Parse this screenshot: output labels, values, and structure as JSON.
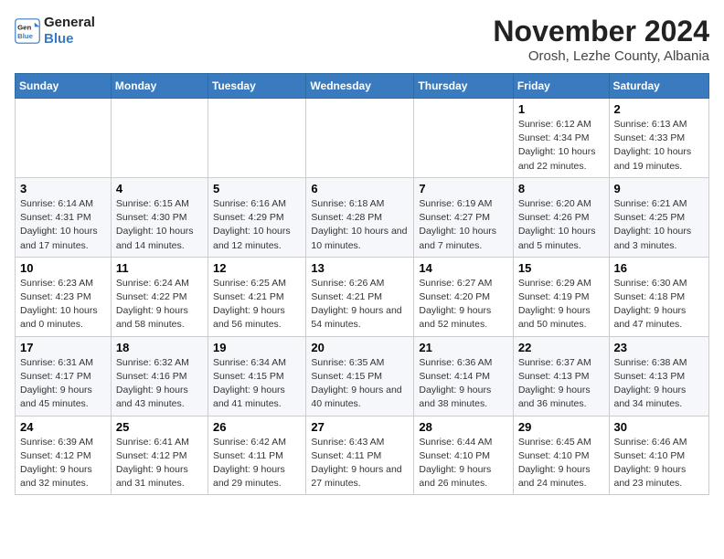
{
  "logo": {
    "line1": "General",
    "line2": "Blue"
  },
  "title": "November 2024",
  "location": "Orosh, Lezhe County, Albania",
  "headers": [
    "Sunday",
    "Monday",
    "Tuesday",
    "Wednesday",
    "Thursday",
    "Friday",
    "Saturday"
  ],
  "weeks": [
    [
      {
        "day": "",
        "info": ""
      },
      {
        "day": "",
        "info": ""
      },
      {
        "day": "",
        "info": ""
      },
      {
        "day": "",
        "info": ""
      },
      {
        "day": "",
        "info": ""
      },
      {
        "day": "1",
        "info": "Sunrise: 6:12 AM\nSunset: 4:34 PM\nDaylight: 10 hours and 22 minutes."
      },
      {
        "day": "2",
        "info": "Sunrise: 6:13 AM\nSunset: 4:33 PM\nDaylight: 10 hours and 19 minutes."
      }
    ],
    [
      {
        "day": "3",
        "info": "Sunrise: 6:14 AM\nSunset: 4:31 PM\nDaylight: 10 hours and 17 minutes."
      },
      {
        "day": "4",
        "info": "Sunrise: 6:15 AM\nSunset: 4:30 PM\nDaylight: 10 hours and 14 minutes."
      },
      {
        "day": "5",
        "info": "Sunrise: 6:16 AM\nSunset: 4:29 PM\nDaylight: 10 hours and 12 minutes."
      },
      {
        "day": "6",
        "info": "Sunrise: 6:18 AM\nSunset: 4:28 PM\nDaylight: 10 hours and 10 minutes."
      },
      {
        "day": "7",
        "info": "Sunrise: 6:19 AM\nSunset: 4:27 PM\nDaylight: 10 hours and 7 minutes."
      },
      {
        "day": "8",
        "info": "Sunrise: 6:20 AM\nSunset: 4:26 PM\nDaylight: 10 hours and 5 minutes."
      },
      {
        "day": "9",
        "info": "Sunrise: 6:21 AM\nSunset: 4:25 PM\nDaylight: 10 hours and 3 minutes."
      }
    ],
    [
      {
        "day": "10",
        "info": "Sunrise: 6:23 AM\nSunset: 4:23 PM\nDaylight: 10 hours and 0 minutes."
      },
      {
        "day": "11",
        "info": "Sunrise: 6:24 AM\nSunset: 4:22 PM\nDaylight: 9 hours and 58 minutes."
      },
      {
        "day": "12",
        "info": "Sunrise: 6:25 AM\nSunset: 4:21 PM\nDaylight: 9 hours and 56 minutes."
      },
      {
        "day": "13",
        "info": "Sunrise: 6:26 AM\nSunset: 4:21 PM\nDaylight: 9 hours and 54 minutes."
      },
      {
        "day": "14",
        "info": "Sunrise: 6:27 AM\nSunset: 4:20 PM\nDaylight: 9 hours and 52 minutes."
      },
      {
        "day": "15",
        "info": "Sunrise: 6:29 AM\nSunset: 4:19 PM\nDaylight: 9 hours and 50 minutes."
      },
      {
        "day": "16",
        "info": "Sunrise: 6:30 AM\nSunset: 4:18 PM\nDaylight: 9 hours and 47 minutes."
      }
    ],
    [
      {
        "day": "17",
        "info": "Sunrise: 6:31 AM\nSunset: 4:17 PM\nDaylight: 9 hours and 45 minutes."
      },
      {
        "day": "18",
        "info": "Sunrise: 6:32 AM\nSunset: 4:16 PM\nDaylight: 9 hours and 43 minutes."
      },
      {
        "day": "19",
        "info": "Sunrise: 6:34 AM\nSunset: 4:15 PM\nDaylight: 9 hours and 41 minutes."
      },
      {
        "day": "20",
        "info": "Sunrise: 6:35 AM\nSunset: 4:15 PM\nDaylight: 9 hours and 40 minutes."
      },
      {
        "day": "21",
        "info": "Sunrise: 6:36 AM\nSunset: 4:14 PM\nDaylight: 9 hours and 38 minutes."
      },
      {
        "day": "22",
        "info": "Sunrise: 6:37 AM\nSunset: 4:13 PM\nDaylight: 9 hours and 36 minutes."
      },
      {
        "day": "23",
        "info": "Sunrise: 6:38 AM\nSunset: 4:13 PM\nDaylight: 9 hours and 34 minutes."
      }
    ],
    [
      {
        "day": "24",
        "info": "Sunrise: 6:39 AM\nSunset: 4:12 PM\nDaylight: 9 hours and 32 minutes."
      },
      {
        "day": "25",
        "info": "Sunrise: 6:41 AM\nSunset: 4:12 PM\nDaylight: 9 hours and 31 minutes."
      },
      {
        "day": "26",
        "info": "Sunrise: 6:42 AM\nSunset: 4:11 PM\nDaylight: 9 hours and 29 minutes."
      },
      {
        "day": "27",
        "info": "Sunrise: 6:43 AM\nSunset: 4:11 PM\nDaylight: 9 hours and 27 minutes."
      },
      {
        "day": "28",
        "info": "Sunrise: 6:44 AM\nSunset: 4:10 PM\nDaylight: 9 hours and 26 minutes."
      },
      {
        "day": "29",
        "info": "Sunrise: 6:45 AM\nSunset: 4:10 PM\nDaylight: 9 hours and 24 minutes."
      },
      {
        "day": "30",
        "info": "Sunrise: 6:46 AM\nSunset: 4:10 PM\nDaylight: 9 hours and 23 minutes."
      }
    ]
  ]
}
